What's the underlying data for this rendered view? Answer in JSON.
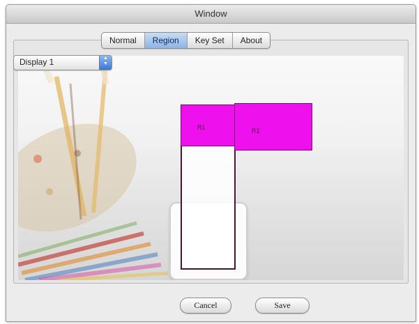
{
  "window": {
    "title": "Window"
  },
  "tabs": [
    {
      "label": "Normal",
      "selected": false
    },
    {
      "label": "Region",
      "selected": true
    },
    {
      "label": "Key Set",
      "selected": false
    },
    {
      "label": "About",
      "selected": false
    }
  ],
  "display_select": {
    "value": "Display 1",
    "arrow_icon": "up-down-arrows-icon"
  },
  "regions": [
    {
      "name": "R1",
      "label": "R1",
      "color": "#ee11ee"
    },
    {
      "name": "R2",
      "label": "R2",
      "color": "#ee11ee"
    }
  ],
  "buttons": {
    "cancel": "Cancel",
    "save": "Save"
  },
  "colors": {
    "accent": "#8db4e6",
    "region": "#ee11ee"
  }
}
